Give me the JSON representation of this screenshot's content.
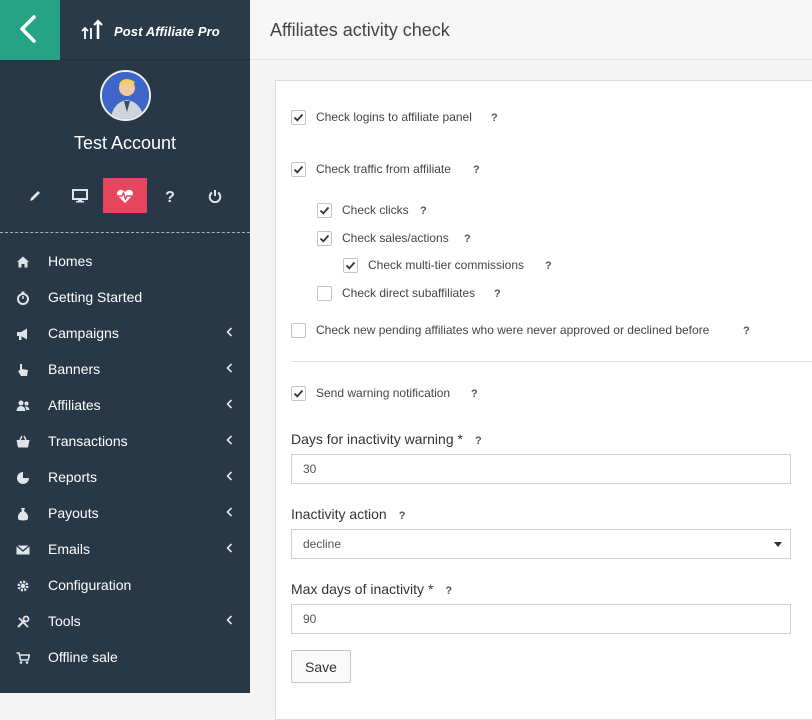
{
  "app": {
    "name": "Post Affiliate Pro"
  },
  "sidebar": {
    "account_name": "Test Account",
    "quick_icons": [
      "edit-icon",
      "monitor-icon",
      "heartbeat-icon",
      "help-icon",
      "power-icon"
    ],
    "active_quick_icon": "heartbeat-icon",
    "items": [
      {
        "label": "Homes",
        "icon": "home-icon",
        "has_submenu": false
      },
      {
        "label": "Getting Started",
        "icon": "stopwatch-icon",
        "has_submenu": false
      },
      {
        "label": "Campaigns",
        "icon": "megaphone-icon",
        "has_submenu": true
      },
      {
        "label": "Banners",
        "icon": "pointer-hand-icon",
        "has_submenu": true
      },
      {
        "label": "Affiliates",
        "icon": "users-icon",
        "has_submenu": true
      },
      {
        "label": "Transactions",
        "icon": "basket-icon",
        "has_submenu": true
      },
      {
        "label": "Reports",
        "icon": "pie-chart-icon",
        "has_submenu": true
      },
      {
        "label": "Payouts",
        "icon": "money-bag-icon",
        "has_submenu": true
      },
      {
        "label": "Emails",
        "icon": "envelope-icon",
        "has_submenu": true
      },
      {
        "label": "Configuration",
        "icon": "gear-icon",
        "has_submenu": false
      },
      {
        "label": "Tools",
        "icon": "tools-icon",
        "has_submenu": true
      },
      {
        "label": "Offline sale",
        "icon": "cart-icon",
        "has_submenu": false
      }
    ]
  },
  "header": {
    "title": "Affiliates activity check"
  },
  "form": {
    "checks": [
      {
        "label": "Check logins to affiliate panel",
        "checked": true
      },
      {
        "label": "Check traffic from affiliate",
        "checked": true
      },
      {
        "label": "Check clicks",
        "checked": true
      },
      {
        "label": "Check sales/actions",
        "checked": true
      },
      {
        "label": "Check multi-tier commissions",
        "checked": true
      },
      {
        "label": "Check direct subaffiliates",
        "checked": false
      },
      {
        "label": "Check new pending affiliates who were never approved or declined before",
        "checked": false
      },
      {
        "label": "Send warning notification",
        "checked": true
      }
    ],
    "help_mark": "?",
    "days_warning": {
      "label": "Days for inactivity warning *",
      "value": "30"
    },
    "inactivity_action": {
      "label": "Inactivity action",
      "value": "decline"
    },
    "max_days": {
      "label": "Max days of inactivity *",
      "value": "90"
    },
    "save_label": "Save"
  },
  "colors": {
    "sidebar_bg": "#293846",
    "back_button": "#26a385",
    "active_icon": "#e7445d"
  }
}
